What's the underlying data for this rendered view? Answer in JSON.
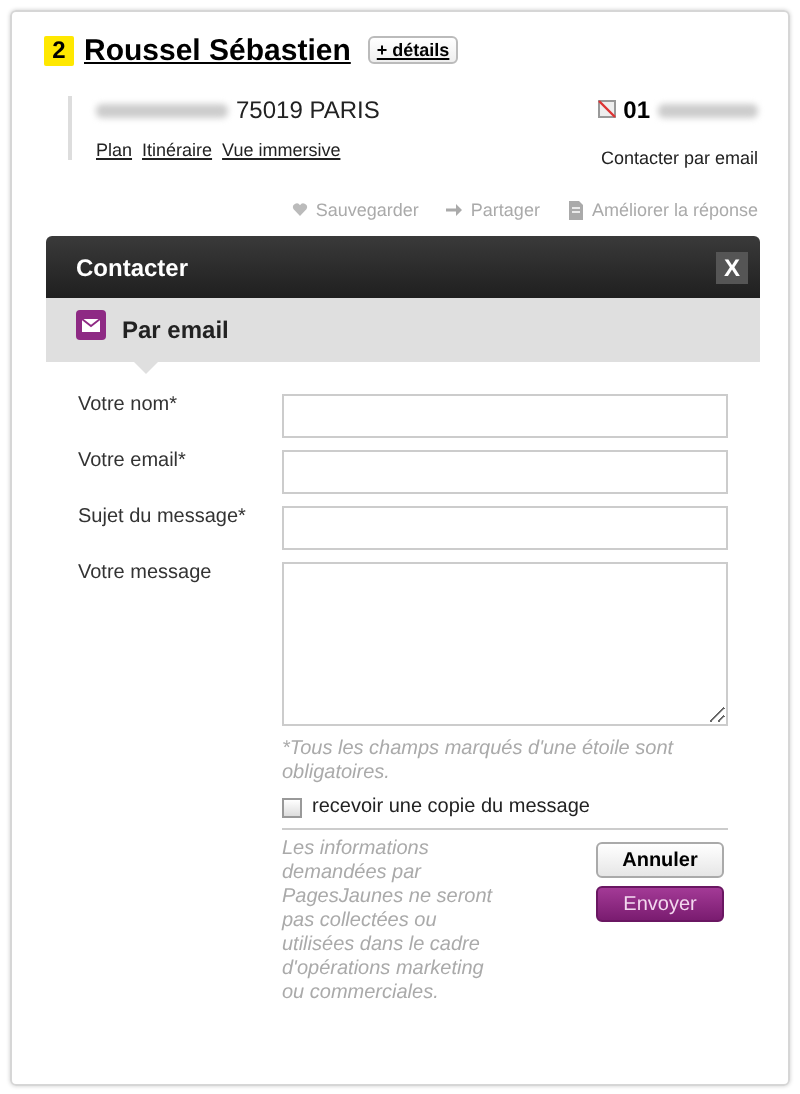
{
  "listing": {
    "rank": "2",
    "name": "Roussel Sébastien",
    "details_button": "+ détails",
    "address": "75019 PARIS",
    "links": [
      "Plan",
      "Itinéraire",
      "Vue immersive"
    ],
    "phone": "01",
    "contact_link": "Contacter par email",
    "actions": [
      {
        "label": "Sauvegarder",
        "kind": "heart"
      },
      {
        "label": "Partager",
        "kind": "arrow"
      },
      {
        "label": "Améliorer la réponse",
        "kind": "doc"
      }
    ]
  },
  "dialog": {
    "title": "Contacter",
    "close": "X",
    "section": "Par email",
    "fields": [
      {
        "label": "Votre nom*",
        "kind": "input"
      },
      {
        "label": "Votre email*",
        "kind": "input"
      },
      {
        "label": "Sujet du message*",
        "kind": "input"
      },
      {
        "label": "Votre message",
        "kind": "textarea"
      }
    ],
    "required_note": "*Tous les champs marqués d'une étoile sont obligatoires.",
    "copy_checkbox": {
      "label": "recevoir une copie du message",
      "checked": false
    },
    "disclaimer": "Les informations demandées par PagesJaunes ne seront pas collectées ou utilisées dans le cadre d'opérations marketing ou commerciales.",
    "buttons": [
      {
        "label": "Annuler",
        "kind": "secondary"
      },
      {
        "label": "Envoyer",
        "kind": "primary"
      }
    ]
  }
}
